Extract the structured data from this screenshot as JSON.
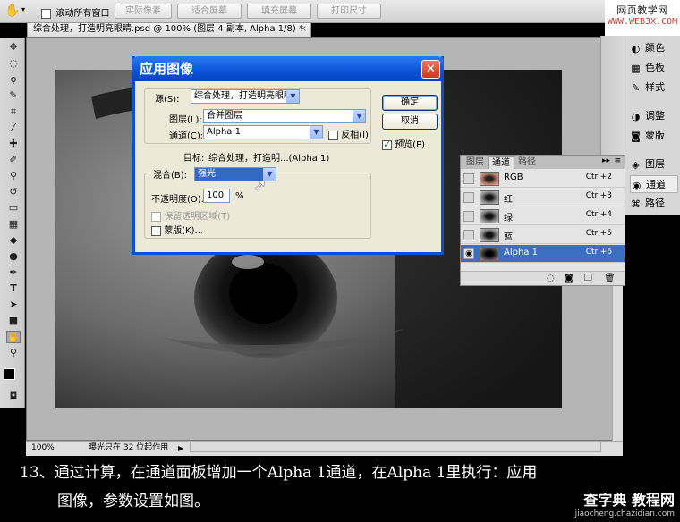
{
  "options_bar": {
    "scroll_all_label": "滚动所有窗口",
    "scroll_all_checked": false,
    "buttons": [
      "实际像素",
      "适合屏幕",
      "填充屏幕",
      "打印尺寸"
    ]
  },
  "watermark_top": {
    "line1": "网页教学网",
    "line2": "WWW.WEB3X.COM"
  },
  "document_tab": {
    "title": "综合处理，打造明亮眼睛.psd @ 100% (图层 4 副本, Alpha 1/8) *",
    "close": "×"
  },
  "status_bar": {
    "zoom": "100%",
    "info": "曝光只在 32 位起作用"
  },
  "right_panels": [
    {
      "label": "颜色",
      "icon": "color-icon"
    },
    {
      "label": "色板",
      "icon": "swatches-icon"
    },
    {
      "label": "样式",
      "icon": "styles-icon"
    },
    {
      "label": "调整",
      "icon": "adjustments-icon"
    },
    {
      "label": "蒙版",
      "icon": "masks-icon"
    },
    {
      "label": "图层",
      "icon": "layers-icon"
    },
    {
      "label": "通道",
      "icon": "channels-icon",
      "selected": true
    },
    {
      "label": "路径",
      "icon": "paths-icon"
    }
  ],
  "channels_panel": {
    "tabs": [
      "图层",
      "通道",
      "路径"
    ],
    "active_tab": "通道",
    "rows": [
      {
        "name": "RGB",
        "shortcut": "Ctrl+2"
      },
      {
        "name": "红",
        "shortcut": "Ctrl+3"
      },
      {
        "name": "绿",
        "shortcut": "Ctrl+4"
      },
      {
        "name": "蓝",
        "shortcut": "Ctrl+5"
      },
      {
        "name": "Alpha 1",
        "shortcut": "Ctrl+6",
        "selected": true
      }
    ]
  },
  "dialog": {
    "title": "应用图像",
    "source_label": "源(S):",
    "source_value": "综合处理，打造明亮眼睛...",
    "layer_label": "图层(L):",
    "layer_value": "合并图层",
    "channel_label": "通道(C):",
    "channel_value": "Alpha 1",
    "invert_label": "反相(I)",
    "invert_checked": false,
    "target_label": "目标:",
    "target_value": "综合处理，打造明...(Alpha 1)",
    "blending_label": "混合(B):",
    "blending_value": "强光",
    "opacity_label": "不透明度(O):",
    "opacity_value": "100",
    "opacity_unit": "%",
    "preserve_label": "保留透明区域(T)",
    "mask_label": "蒙版(K)...",
    "ok_label": "确定",
    "cancel_label": "取消",
    "preview_label": "预览(P)",
    "preview_checked": true
  },
  "caption": {
    "line1": "13、通过计算，在通道面板增加一个Alpha 1通道，在Alpha 1里执行：应用",
    "line2": "图像，参数设置如图。"
  },
  "watermark_bottom": {
    "line1": "查字典 教程网",
    "line2": "jiaocheng.chazidian.com"
  }
}
